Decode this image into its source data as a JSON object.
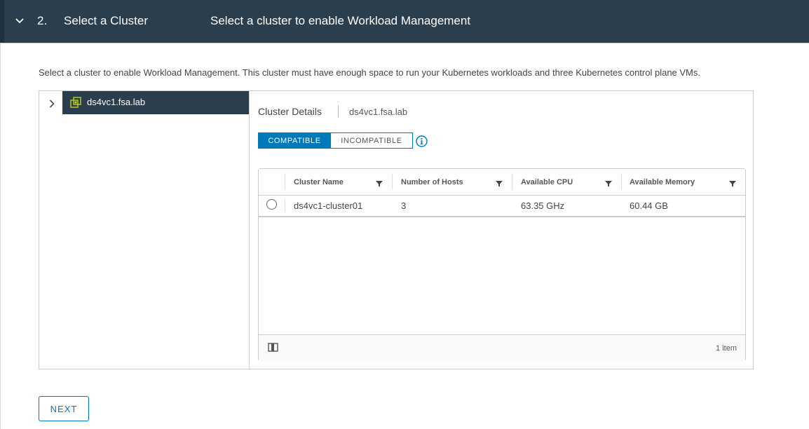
{
  "step": {
    "number": "2.",
    "title": "Select a Cluster",
    "subtitle": "Select a cluster to enable Workload Management"
  },
  "description": "Select a cluster to enable Workload Management. This cluster must have enough space to run your Kubernetes workloads and three Kubernetes control plane VMs.",
  "tree": {
    "node_label": "ds4vc1.fsa.lab",
    "node_icon": "vcenter-icon"
  },
  "details": {
    "title": "Cluster Details",
    "value": "ds4vc1.fsa.lab"
  },
  "toggle": {
    "compatible": "COMPATIBLE",
    "incompatible": "INCOMPATIBLE",
    "selected": "COMPATIBLE"
  },
  "grid": {
    "columns": [
      "Cluster Name",
      "Number of Hosts",
      "Available CPU",
      "Available Memory"
    ],
    "rows": [
      {
        "cluster_name": "ds4vc1-cluster01",
        "hosts": "3",
        "cpu": "63.35 GHz",
        "memory": "60.44 GB",
        "selected": false
      }
    ],
    "footer_count": "1 item"
  },
  "next_label": "NEXT",
  "colors": {
    "header_bg": "#2b3e4e",
    "accent": "#0079b8",
    "tree_selected_bg": "#2b3e4e",
    "vcenter_icon": "#c1cd23"
  }
}
